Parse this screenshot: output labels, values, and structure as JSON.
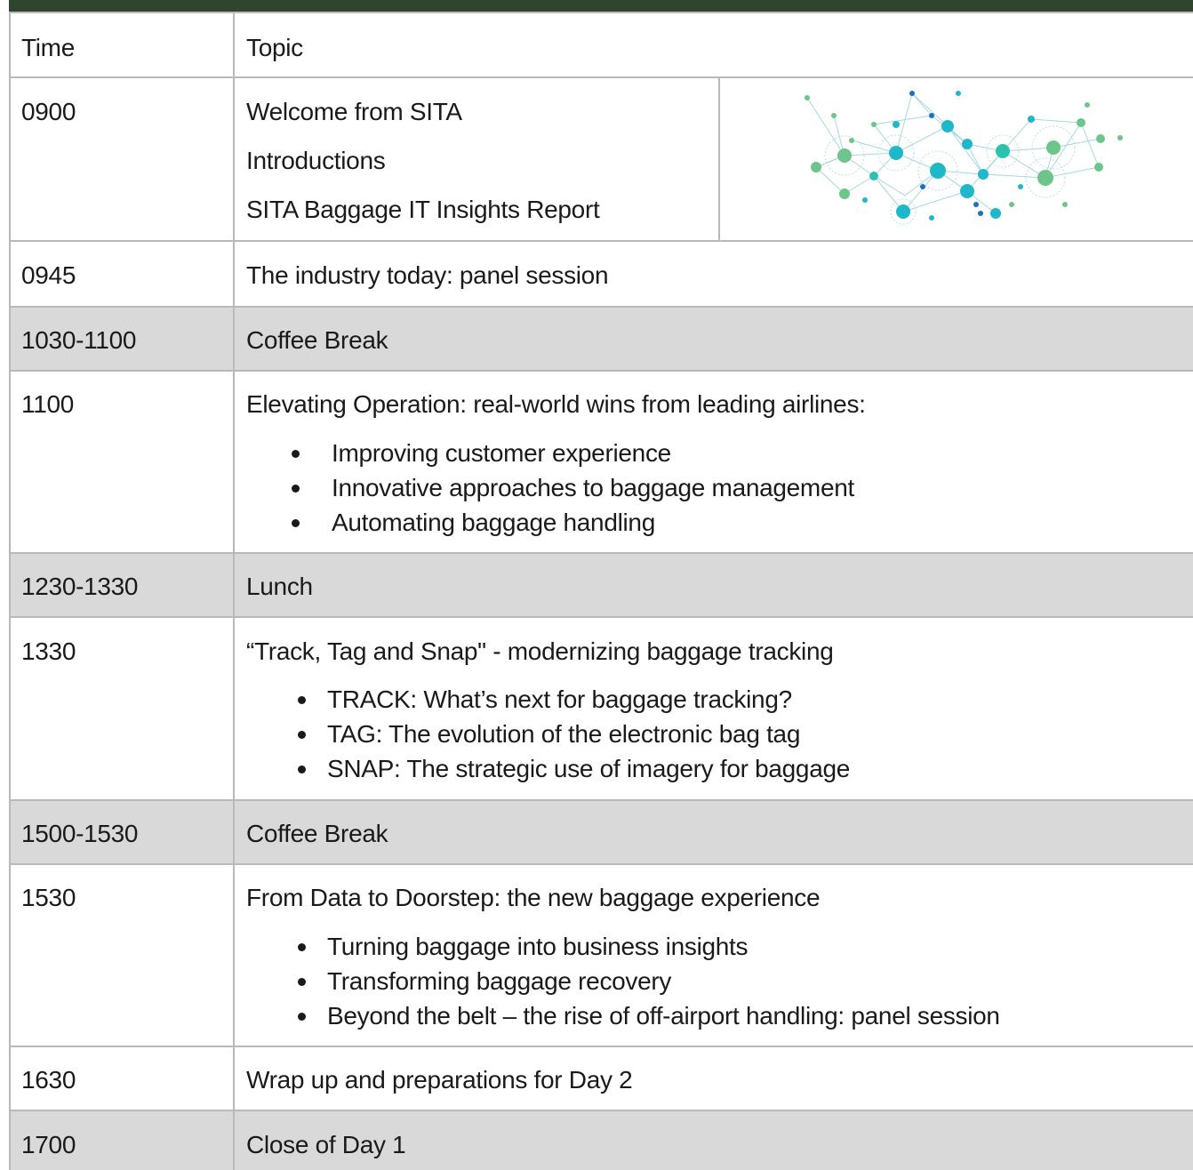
{
  "table": {
    "header": {
      "time": "Time",
      "topic": "Topic"
    },
    "rows": [
      {
        "time": "0900",
        "topics": [
          "Welcome from SITA",
          "Introductions",
          "SITA Baggage IT Insights Report"
        ]
      },
      {
        "time": "0945",
        "topic": "The industry today: panel session"
      },
      {
        "time": "1030-1100",
        "topic": "Coffee Break",
        "shaded": true
      },
      {
        "time": "1100",
        "topic": "Elevating Operation: real-world wins from leading airlines:",
        "bullets": [
          "Improving customer experience",
          "Innovative approaches to baggage management",
          "Automating baggage handling"
        ]
      },
      {
        "time": "1230-1330",
        "topic": "Lunch",
        "shaded": true
      },
      {
        "time": "1330",
        "topic": "“Track, Tag and Snap\" - modernizing baggage tracking",
        "bullets": [
          "TRACK: What’s next for baggage tracking?",
          "TAG: The evolution of the electronic bag tag",
          "SNAP: The strategic use of imagery for baggage"
        ]
      },
      {
        "time": "1500-1530",
        "topic": "Coffee Break",
        "shaded": true
      },
      {
        "time": "1530",
        "topic": "From Data to Doorstep: the new baggage experience",
        "bullets": [
          "Turning baggage into business insights",
          "Transforming baggage recovery",
          "Beyond the belt – the rise of off-airport handling: panel session"
        ]
      },
      {
        "time": "1630",
        "topic": "Wrap up and preparations for Day 2"
      },
      {
        "time": "1700",
        "topic": "Close of Day 1",
        "shaded": true
      }
    ]
  },
  "colors": {
    "header_bar": "#2f4530",
    "shaded_row": "#d9d9d9",
    "border": "#b9b9b9",
    "network_teal": "#1fb8c9",
    "network_green": "#6cc58a",
    "network_blue": "#1e6fc4"
  },
  "illustration": {
    "icon": "network-graph-icon"
  }
}
